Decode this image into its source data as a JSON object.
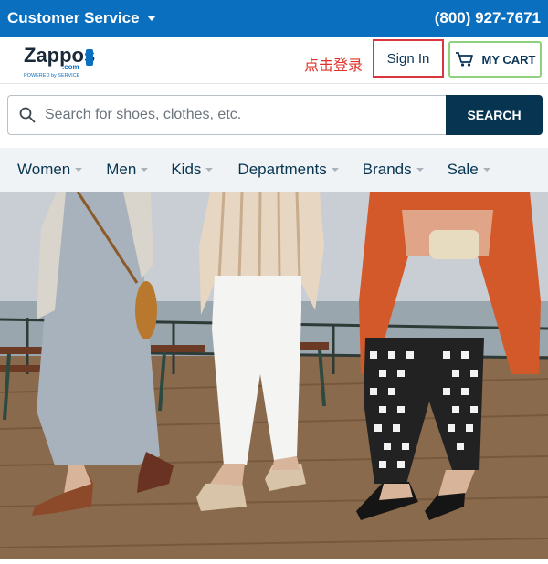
{
  "topbar": {
    "customer_service": "Customer Service",
    "phone": "(800) 927-7671"
  },
  "header": {
    "logo_text": "Zappos",
    "logo_sub": ".com",
    "logo_tagline": "POWERED by SERVICE",
    "login_hint": "点击登录",
    "sign_in": "Sign In",
    "cart": "MY CART"
  },
  "search": {
    "placeholder": "Search for shoes, clothes, etc.",
    "button": "SEARCH"
  },
  "nav": {
    "items": [
      {
        "label": "Women"
      },
      {
        "label": "Men"
      },
      {
        "label": "Kids"
      },
      {
        "label": "Departments"
      },
      {
        "label": "Brands"
      },
      {
        "label": "Sale"
      }
    ]
  },
  "colors": {
    "topbar": "#0b6fc0",
    "search_button": "#073551",
    "signin_border": "#d9363e",
    "cart_border": "#8fd17e",
    "login_hint": "#e0322a"
  }
}
